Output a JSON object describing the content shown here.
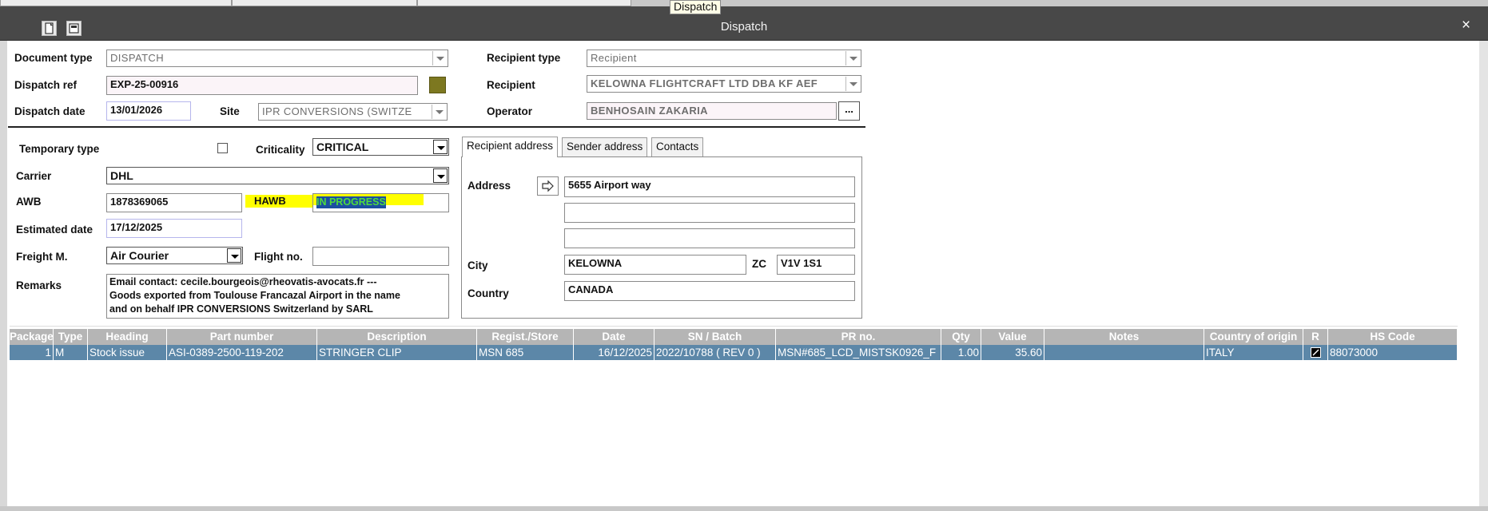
{
  "tooltip": "Dispatch",
  "window": {
    "title": "Dispatch",
    "close_glyph": "×"
  },
  "icons": {
    "doc_icon": "document-icon",
    "window_icon": "window-icon",
    "arrow_icon": "arrow-right-icon",
    "ellipsis": "..."
  },
  "header": {
    "document_type_label": "Document type",
    "document_type_value": "DISPATCH",
    "dispatch_ref_label": "Dispatch ref",
    "dispatch_ref_value": "EXP-25-00916",
    "dispatch_date_label": "Dispatch date",
    "dispatch_date_value": "13/01/2026",
    "site_label": "Site",
    "site_value": "IPR CONVERSIONS (SWITZE",
    "recipient_type_label": "Recipient type",
    "recipient_type_value": "Recipient",
    "recipient_label": "Recipient",
    "recipient_value": "KELOWNA FLIGHTCRAFT LTD DBA KF AEF",
    "operator_label": "Operator",
    "operator_value": "BENHOSAIN ZAKARIA"
  },
  "shipping": {
    "temporary_type_label": "Temporary type",
    "criticality_label": "Criticality",
    "criticality_value": "CRITICAL",
    "carrier_label": "Carrier",
    "carrier_value": "DHL",
    "awb_label": "AWB",
    "awb_value": "1878369065",
    "hawb_label": "HAWB",
    "hawb_value": "IN PROGRESS",
    "estimated_date_label": "Estimated date",
    "estimated_date_value": "17/12/2025",
    "freight_label": "Freight M.",
    "freight_value": "Air Courier",
    "flight_label": "Flight no.",
    "flight_value": "",
    "remarks_label": "Remarks",
    "remarks_lines": [
      "Email contact: cecile.bourgeois@rheovatis-avocats.fr  ---",
      "Goods exported from Toulouse Francazal Airport in the name",
      "and on behalf IPR CONVERSIONS Switzerland by SARL"
    ]
  },
  "address_tabs": [
    "Recipient address",
    "Sender address",
    "Contacts"
  ],
  "address": {
    "address_label": "Address",
    "line1": "5655 Airport way",
    "line2": "",
    "line3": "",
    "city_label": "City",
    "city_value": "KELOWNA",
    "zc_label": "ZC",
    "zc_value": "V1V 1S1",
    "country_label": "Country",
    "country_value": "CANADA"
  },
  "grid": {
    "columns": [
      "Package",
      "Type",
      "Heading",
      "Part number",
      "Description",
      "Regist./Store",
      "Date",
      "SN / Batch",
      "PR no.",
      "Qty",
      "Value",
      "Notes",
      "Country of origin",
      "R",
      "HS Code"
    ],
    "rows": [
      {
        "package": "1",
        "type": "M",
        "heading": "Stock issue",
        "part_number": "ASI-0389-2500-119-202",
        "description": "STRINGER CLIP",
        "store": "MSN 685",
        "date": "16/12/2025",
        "sn_batch": "2022/10788 ( REV 0 )",
        "pr_no": "MSN#685_LCD_MISTSK0926_F",
        "qty": "1.00",
        "value": "35.60",
        "notes": "",
        "country": "ITALY",
        "r": "checked",
        "hs_code": "88073000"
      }
    ]
  },
  "colors": {
    "titlebar": "#484848",
    "row_selected": "#5c87a8",
    "header_grid": "#b5b5b5",
    "highlight": "#ffff00"
  }
}
